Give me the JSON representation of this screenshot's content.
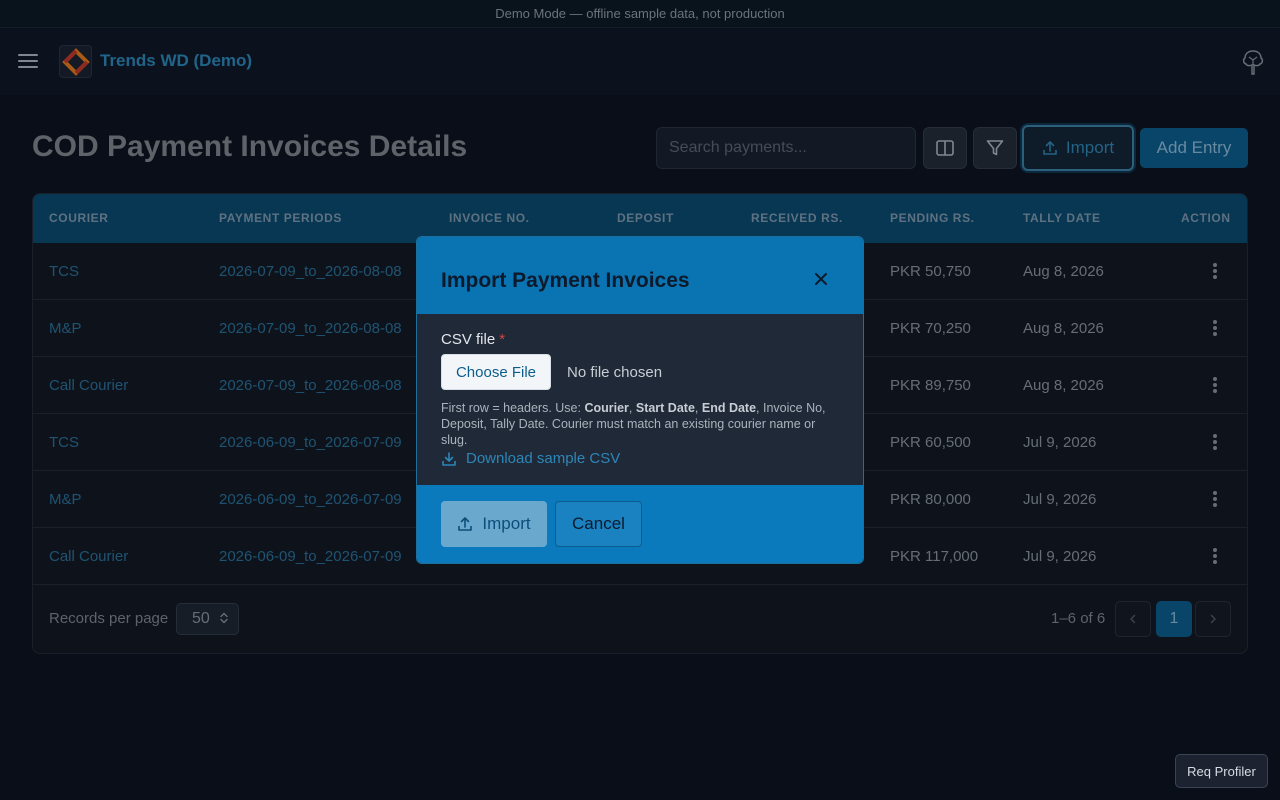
{
  "banner": {
    "text": "Demo Mode — offline sample data, not production"
  },
  "app": {
    "title": "Trends WD (Demo)",
    "menu_icon": "hamburger-icon",
    "logo_icon": "app-logo",
    "profile_icon": "tree-avatar-icon"
  },
  "page": {
    "title": "COD Payment Invoices Details"
  },
  "toolbar": {
    "search_placeholder": "Search payments...",
    "columns_icon": "columns-icon",
    "filter_icon": "filter-icon",
    "import_label": "Import",
    "add_entry_label": "Add Entry"
  },
  "table": {
    "columns": [
      "COURIER",
      "PAYMENT PERIODS",
      "INVOICE NO.",
      "DEPOSIT",
      "RECEIVED RS.",
      "PENDING RS.",
      "TALLY DATE",
      "ACTION"
    ],
    "rows": [
      {
        "courier": "TCS",
        "period": "2026-07-09_to_2026-08-08",
        "pending": "PKR 50,750",
        "tally_date": "Aug 8, 2026"
      },
      {
        "courier": "M&P",
        "period": "2026-07-09_to_2026-08-08",
        "pending": "PKR 70,250",
        "tally_date": "Aug 8, 2026"
      },
      {
        "courier": "Call Courier",
        "period": "2026-07-09_to_2026-08-08",
        "pending": "PKR 89,750",
        "tally_date": "Aug 8, 2026"
      },
      {
        "courier": "TCS",
        "period": "2026-06-09_to_2026-07-09",
        "pending": "PKR 60,500",
        "tally_date": "Jul 9, 2026"
      },
      {
        "courier": "M&P",
        "period": "2026-06-09_to_2026-07-09",
        "pending": "PKR 80,000",
        "tally_date": "Jul 9, 2026"
      },
      {
        "courier": "Call Courier",
        "period": "2026-06-09_to_2026-07-09",
        "pending": "PKR 117,000",
        "tally_date": "Jul 9, 2026"
      }
    ],
    "footer": {
      "records_label": "Records per page",
      "per_page": "50",
      "range": "1–6 of 6",
      "current_page": "1"
    }
  },
  "modal": {
    "title": "Import Payment Invoices",
    "field_label": "CSV file",
    "required_mark": "*",
    "choose_label": "Choose File",
    "no_file": "No file chosen",
    "help": {
      "prefix": "First row = headers. Use: ",
      "b1": "Courier",
      "sep1": ", ",
      "b2": "Start Date",
      "sep2": ", ",
      "b3": "End Date",
      "suffix": ", Invoice No, Deposit, Tally Date. Courier must match an existing courier name or slug."
    },
    "sample_link": "Download sample CSV",
    "import_label": "Import",
    "cancel_label": "Cancel"
  },
  "profiler": {
    "label": "Req Profiler"
  },
  "colors": {
    "accent": "#0a73b2",
    "link": "#2a6f99",
    "background": "#0c1321"
  }
}
